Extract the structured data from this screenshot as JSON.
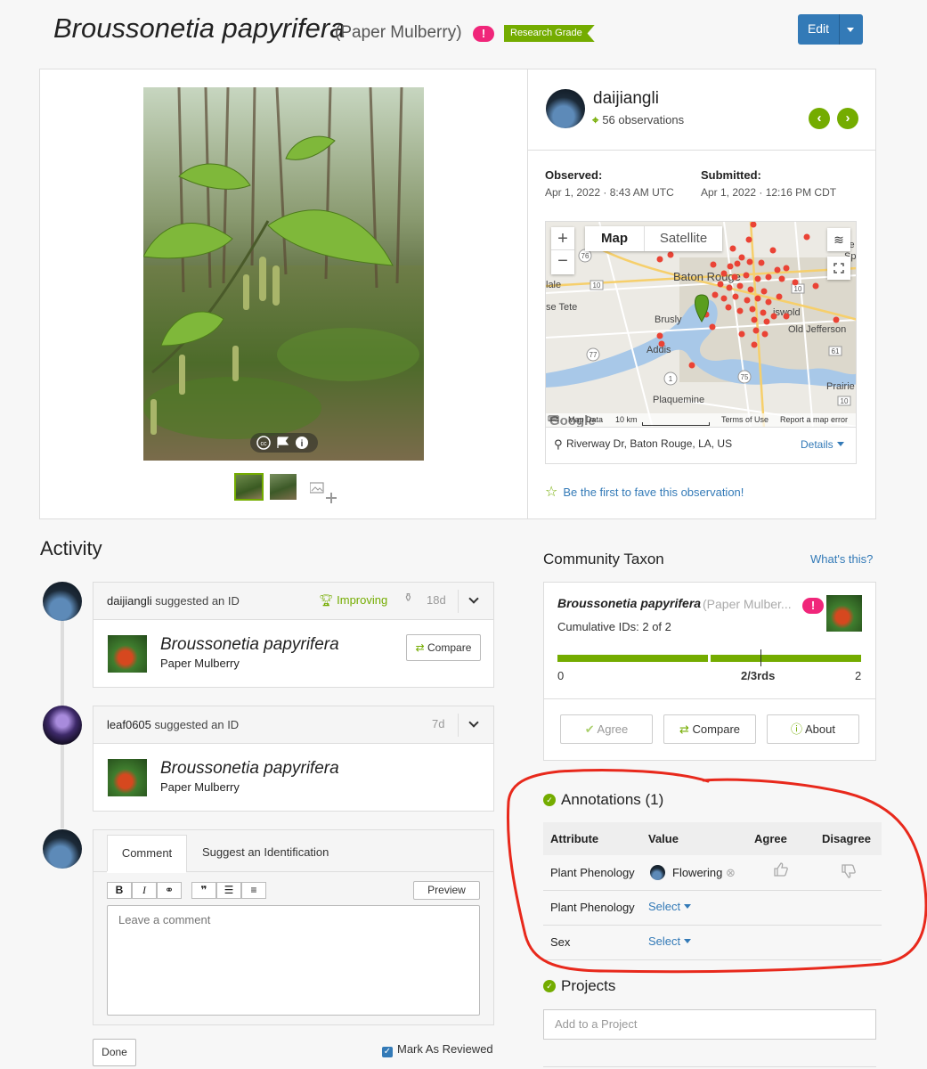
{
  "header": {
    "scientific_name": "Broussonetia papyrifera",
    "common_name": "(Paper Mulberry)",
    "warning_icon": "!",
    "quality_badge": "Research Grade",
    "edit_label": "Edit"
  },
  "observer": {
    "username": "daijiangli",
    "observations": "56 observations",
    "observed_label": "Observed:",
    "observed_value": "Apr 1, 2022 · 8:43 AM UTC",
    "submitted_label": "Submitted:",
    "submitted_value": "Apr 1, 2022 · 12:16 PM CDT"
  },
  "map": {
    "tab_map": "Map",
    "tab_satellite": "Satellite",
    "zoom_in": "+",
    "zoom_out": "−",
    "labels": [
      "Baton Rouge",
      "Brusly",
      "Addis",
      "Plaquemine",
      "Old Jefferson",
      "Prairie",
      "se Tete",
      "lale",
      "iswold",
      "le",
      "Sp"
    ],
    "road_badges": [
      "76",
      "10",
      "77",
      "1",
      "75",
      "10",
      "61",
      "10"
    ],
    "footer_data": "Map Data",
    "footer_scale": "10 km",
    "footer_terms": "Terms of Use",
    "footer_report": "Report a map error",
    "google": "Google",
    "location": "Riverway Dr, Baton Rouge, LA, US",
    "details": "Details"
  },
  "fave": "Be the first to fave this observation!",
  "activity": {
    "title": "Activity",
    "items": [
      {
        "user": "daijiangli",
        "action": "suggested an ID",
        "status": "Improving",
        "age": "18d",
        "taxon": "Broussonetia papyrifera",
        "common": "Paper Mulberry",
        "compare": "Compare"
      },
      {
        "user": "leaf0605",
        "action": "suggested an ID",
        "age": "7d",
        "taxon": "Broussonetia papyrifera",
        "common": "Paper Mulberry"
      }
    ],
    "tab_comment": "Comment",
    "tab_suggest": "Suggest an Identification",
    "toolbar": [
      "B",
      "I",
      "⚭",
      "❞",
      "☰",
      "≡"
    ],
    "preview": "Preview",
    "placeholder": "Leave a comment",
    "done": "Done",
    "mark_reviewed": "Mark As Reviewed"
  },
  "community_taxon": {
    "title": "Community Taxon",
    "whats_this": "What's this?",
    "name": "Broussonetia papyrifera",
    "common": "(Paper Mulber...",
    "cumulative": "Cumulative IDs: 2 of 2",
    "scale_min": "0",
    "scale_mid": "2/3rds",
    "scale_max": "2",
    "agree": "Agree",
    "compare": "Compare",
    "about": "About"
  },
  "annotations": {
    "title": "Annotations (1)",
    "headers": [
      "Attribute",
      "Value",
      "Agree",
      "Disagree"
    ],
    "rows": [
      {
        "attribute": "Plant Phenology",
        "value": "Flowering"
      },
      {
        "attribute": "Plant Phenology",
        "value": "Select"
      },
      {
        "attribute": "Sex",
        "value": "Select"
      }
    ]
  },
  "projects": {
    "title": "Projects",
    "placeholder": "Add to a Project"
  },
  "colors": {
    "green": "#74ac00",
    "blue": "#337ab7",
    "pink": "#f0267a",
    "highlight_red": "#e8291c"
  }
}
